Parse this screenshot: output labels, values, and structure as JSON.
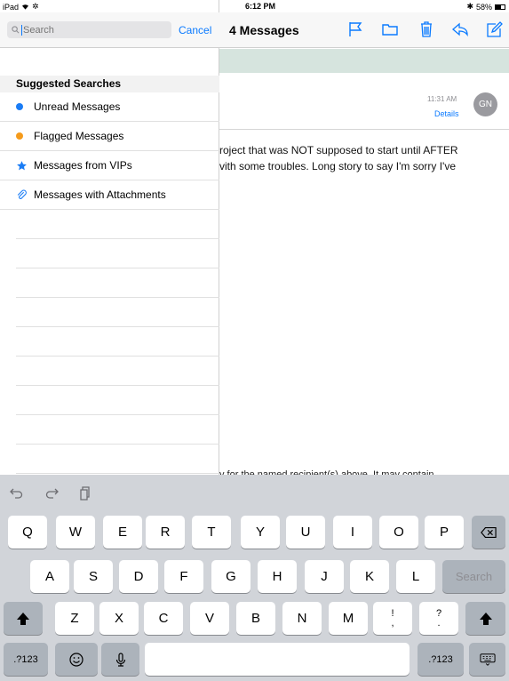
{
  "status_bar": {
    "device": "iPad",
    "time": "6:12 PM",
    "battery_percent": "58%"
  },
  "search": {
    "placeholder": "Search",
    "value": "",
    "cancel_label": "Cancel"
  },
  "suggestions": {
    "header": "Suggested Searches",
    "items": [
      {
        "label": "Unread Messages",
        "icon": "blue-dot-icon",
        "color": "#1a7cf5"
      },
      {
        "label": "Flagged Messages",
        "icon": "orange-dot-icon",
        "color": "#f59b1c"
      },
      {
        "label": "Messages from VIPs",
        "icon": "star-icon",
        "color": "#1a7cf5"
      },
      {
        "label": "Messages with Attachments",
        "icon": "paperclip-icon",
        "color": "#1a7cf5"
      }
    ]
  },
  "message_view": {
    "title": "4 Messages",
    "time": "11:31 AM",
    "details_label": "Details",
    "avatar_initials": "GN",
    "body_lines": [
      "roject that was NOT supposed to start until AFTER",
      "vith some troubles. Long story to say I'm sorry I've"
    ],
    "footer_fragment": "y for the named recipient(s) above. It may contain"
  },
  "keyboard": {
    "rows": [
      [
        "Q",
        "W",
        "E",
        "R",
        "T",
        "Y",
        "U",
        "I",
        "O",
        "P"
      ],
      [
        "A",
        "S",
        "D",
        "F",
        "G",
        "H",
        "J",
        "K",
        "L"
      ],
      [
        "Z",
        "X",
        "C",
        "V",
        "B",
        "N",
        "M",
        "!\n,",
        "?\n."
      ]
    ],
    "search_key": "Search",
    "numbers_key": ".?123",
    "numbers_key_right": ".?123"
  },
  "colors": {
    "accent": "#0a7aff",
    "unread": "#1a7cf5",
    "flagged": "#f59b1c",
    "banner": "#d6e4de"
  }
}
